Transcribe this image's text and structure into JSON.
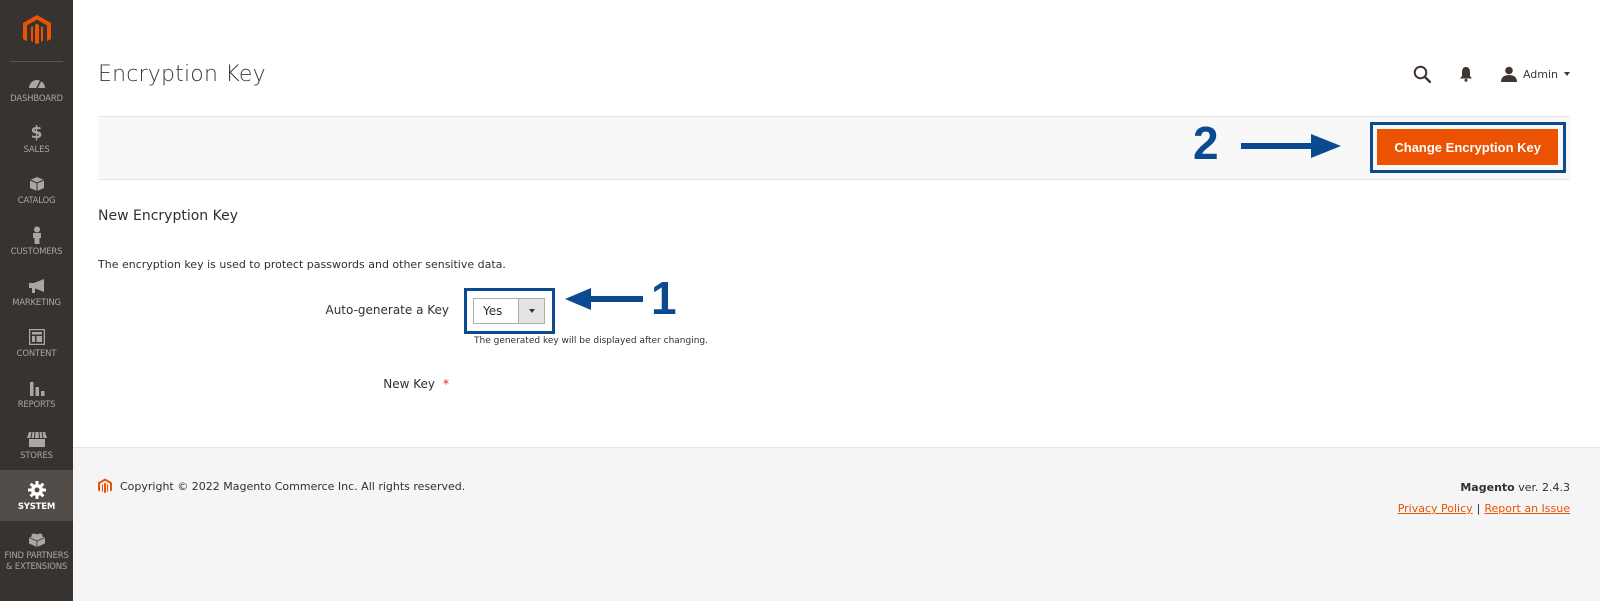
{
  "sidebar": {
    "logo": "magento-logo",
    "items": [
      {
        "label": "Dashboard",
        "icon": "dashboard-icon",
        "active": false
      },
      {
        "label": "Sales",
        "icon": "dollar-icon",
        "active": false
      },
      {
        "label": "Catalog",
        "icon": "box-icon",
        "active": false
      },
      {
        "label": "Customers",
        "icon": "person-icon",
        "active": false
      },
      {
        "label": "Marketing",
        "icon": "megaphone-icon",
        "active": false
      },
      {
        "label": "Content",
        "icon": "layout-icon",
        "active": false
      },
      {
        "label": "Reports",
        "icon": "bar-chart-icon",
        "active": false
      },
      {
        "label": "Stores",
        "icon": "storefront-icon",
        "active": false
      },
      {
        "label": "System",
        "icon": "gear-icon",
        "active": true
      },
      {
        "label": "Find Partners & Extensions",
        "icon": "lego-brick-icon",
        "active": false
      }
    ]
  },
  "header": {
    "title": "Encryption Key",
    "user": "Admin"
  },
  "action_bar": {
    "primary_button": "Change Encryption Key"
  },
  "annotations": {
    "step1": "1",
    "step2": "2",
    "color": "#0c4a8f"
  },
  "form": {
    "section_title": "New Encryption Key",
    "description": "The encryption key is used to protect passwords and other sensitive data.",
    "auto_generate": {
      "label": "Auto-generate a Key",
      "value": "Yes",
      "note": "The generated key will be displayed after changing."
    },
    "new_key": {
      "label": "New Key",
      "required_mark": "*"
    }
  },
  "footer": {
    "copyright": "Copyright © 2022 Magento Commerce Inc. All rights reserved.",
    "brand": "Magento",
    "version": "ver. 2.4.3",
    "privacy_link": "Privacy Policy",
    "separator": "|",
    "report_link": "Report an Issue"
  },
  "colors": {
    "accent": "#eb5202",
    "sidebar_bg": "#373330",
    "sidebar_active": "#524d49"
  }
}
